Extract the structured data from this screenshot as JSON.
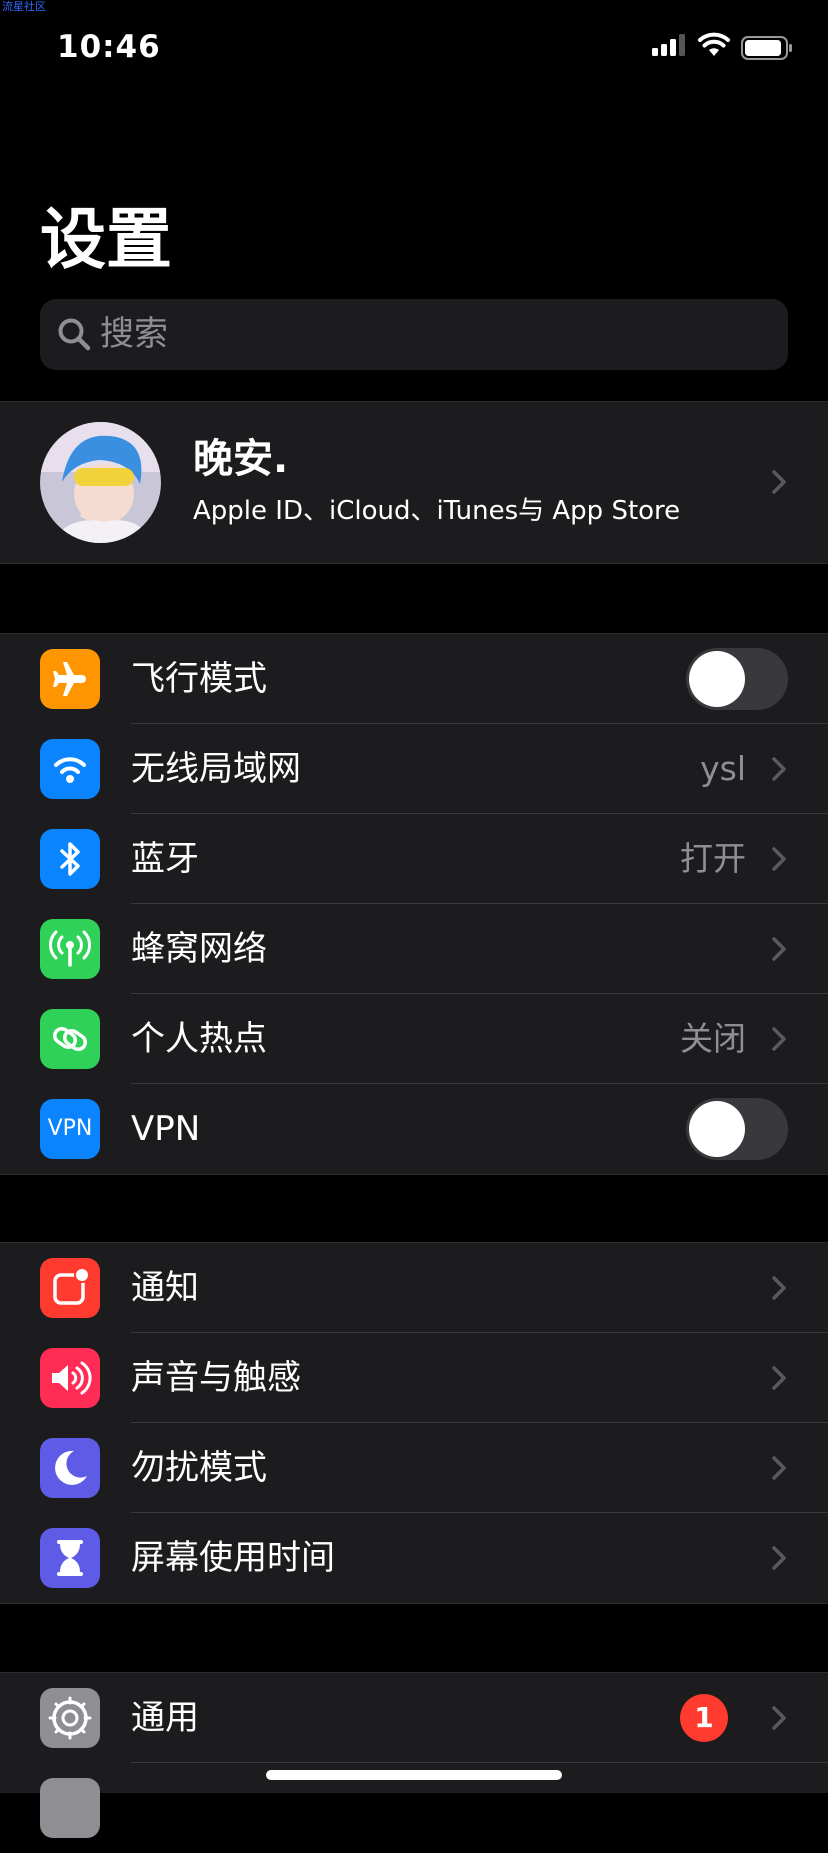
{
  "watermark": "流星社区",
  "status": {
    "time": "10:46"
  },
  "page": {
    "title": "设置"
  },
  "search": {
    "placeholder": "搜索"
  },
  "profile": {
    "name": "晚安.",
    "subtitle": "Apple ID、iCloud、iTunes与 App Store"
  },
  "group1": [
    {
      "label": "飞行模式",
      "icon": "airplane-icon",
      "color": "#ff9500",
      "toggle": false
    },
    {
      "label": "无线局域网",
      "icon": "wifi-icon",
      "color": "#0a84ff",
      "value": "ysl"
    },
    {
      "label": "蓝牙",
      "icon": "bluetooth-icon",
      "color": "#0a84ff",
      "value": "打开"
    },
    {
      "label": "蜂窝网络",
      "icon": "cellular-icon",
      "color": "#30d158"
    },
    {
      "label": "个人热点",
      "icon": "hotspot-icon",
      "color": "#30d158",
      "value": "关闭"
    },
    {
      "label": "VPN",
      "icon": "vpn-icon",
      "icon_text": "VPN",
      "color": "#0a84ff",
      "toggle": false
    }
  ],
  "group2": [
    {
      "label": "通知",
      "icon": "notifications-icon",
      "color": "#ff3b30"
    },
    {
      "label": "声音与触感",
      "icon": "sound-icon",
      "color": "#ff2d55"
    },
    {
      "label": "勿扰模式",
      "icon": "moon-icon",
      "color": "#5e5ce6"
    },
    {
      "label": "屏幕使用时间",
      "icon": "hourglass-icon",
      "color": "#5e5ce6"
    }
  ],
  "group3": [
    {
      "label": "通用",
      "icon": "gear-icon",
      "color": "#8e8e93",
      "badge": "1"
    }
  ]
}
